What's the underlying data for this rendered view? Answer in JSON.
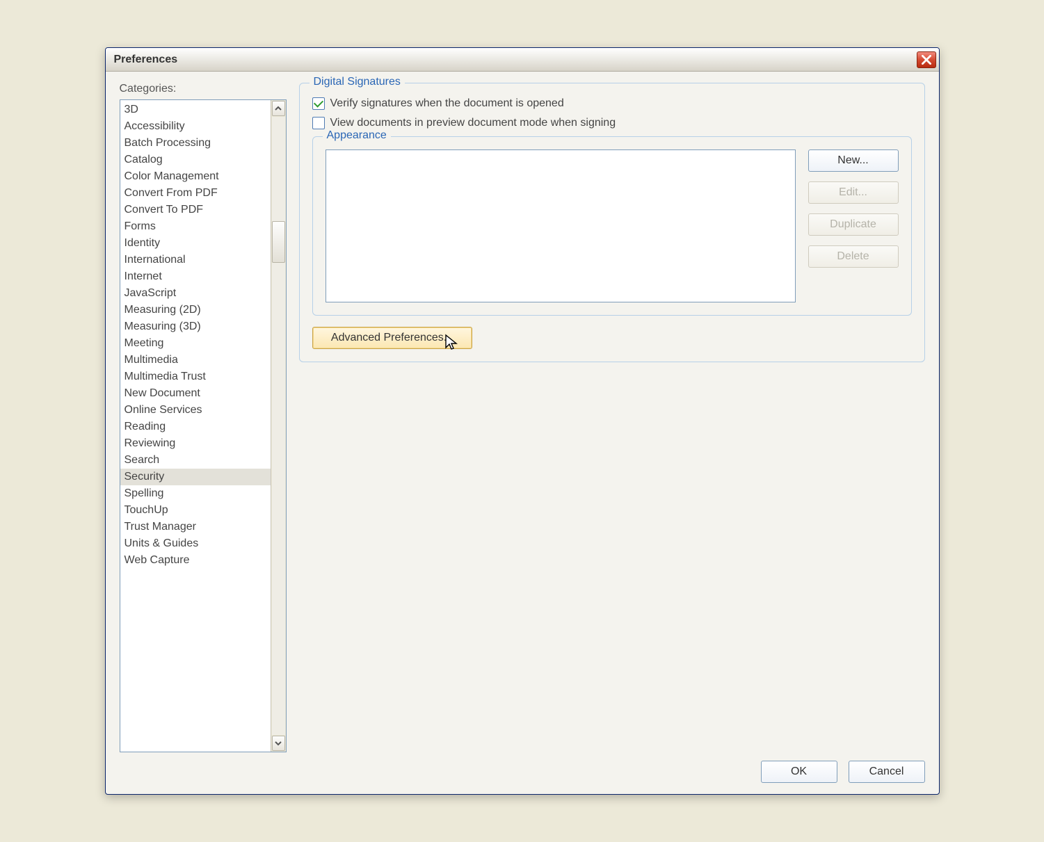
{
  "window": {
    "title": "Preferences"
  },
  "sidebar": {
    "label": "Categories:",
    "selected": "Security",
    "items": [
      "3D",
      "Accessibility",
      "Batch Processing",
      "Catalog",
      "Color Management",
      "Convert From PDF",
      "Convert To PDF",
      "Forms",
      "Identity",
      "International",
      "Internet",
      "JavaScript",
      "Measuring (2D)",
      "Measuring (3D)",
      "Meeting",
      "Multimedia",
      "Multimedia Trust",
      "New Document",
      "Online Services",
      "Reading",
      "Reviewing",
      "Search",
      "Security",
      "Spelling",
      "TouchUp",
      "Trust Manager",
      "Units & Guides",
      "Web Capture"
    ]
  },
  "group": {
    "digital_signatures": "Digital Signatures",
    "verify_label": "Verify signatures when the document is opened",
    "verify_checked": true,
    "preview_label": "View documents in preview document mode when signing",
    "preview_checked": false,
    "appearance_title": "Appearance",
    "buttons": {
      "new": "New...",
      "edit": "Edit...",
      "duplicate": "Duplicate",
      "delete": "Delete"
    },
    "advanced": "Advanced Preferences..."
  },
  "footer": {
    "ok": "OK",
    "cancel": "Cancel"
  }
}
